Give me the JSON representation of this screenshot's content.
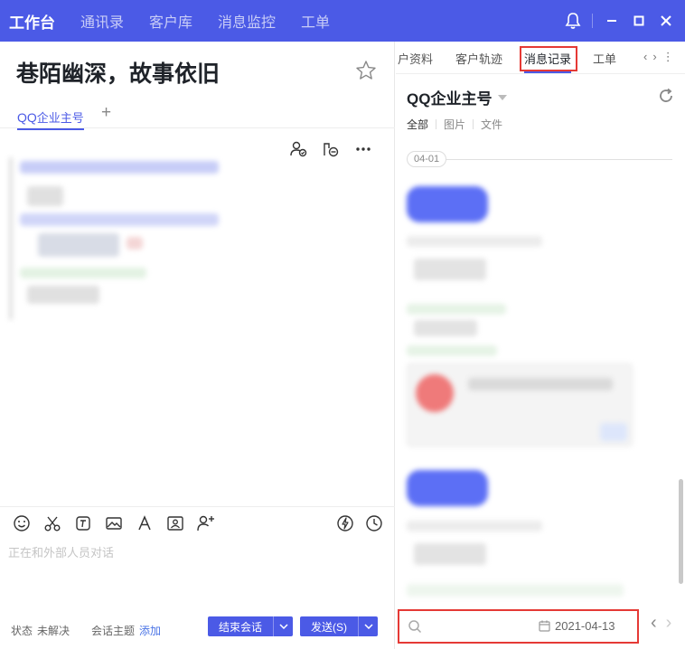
{
  "topbar": {
    "active_label": "工作台",
    "nav": [
      "通讯录",
      "客户库",
      "消息监控",
      "工单"
    ]
  },
  "chat": {
    "title": "巷陌幽深，故事依旧",
    "account_tab_prefix": "QQ",
    "account_tab_suffix": "企业主号",
    "add_tab": "+"
  },
  "composer": {
    "placeholder": "正在和外部人员对话",
    "status_label": "状态",
    "status_value": "未解决",
    "topic_label": "会话主题",
    "topic_action": "添加",
    "end_button": "结束会话",
    "send_button": "发送(S)"
  },
  "right": {
    "tabs": [
      "户资料",
      "客户轨迹",
      "消息记录",
      "工单"
    ],
    "active_tab": "消息记录",
    "account": "QQ企业主号",
    "filters": [
      "全部",
      "图片",
      "文件"
    ],
    "date_separator": "04-01",
    "search": {
      "placeholder": "",
      "date": "2021-04-13"
    }
  },
  "colors": {
    "accent": "#4b5ae6",
    "highlight": "#e53935",
    "link": "#4b74e6"
  }
}
